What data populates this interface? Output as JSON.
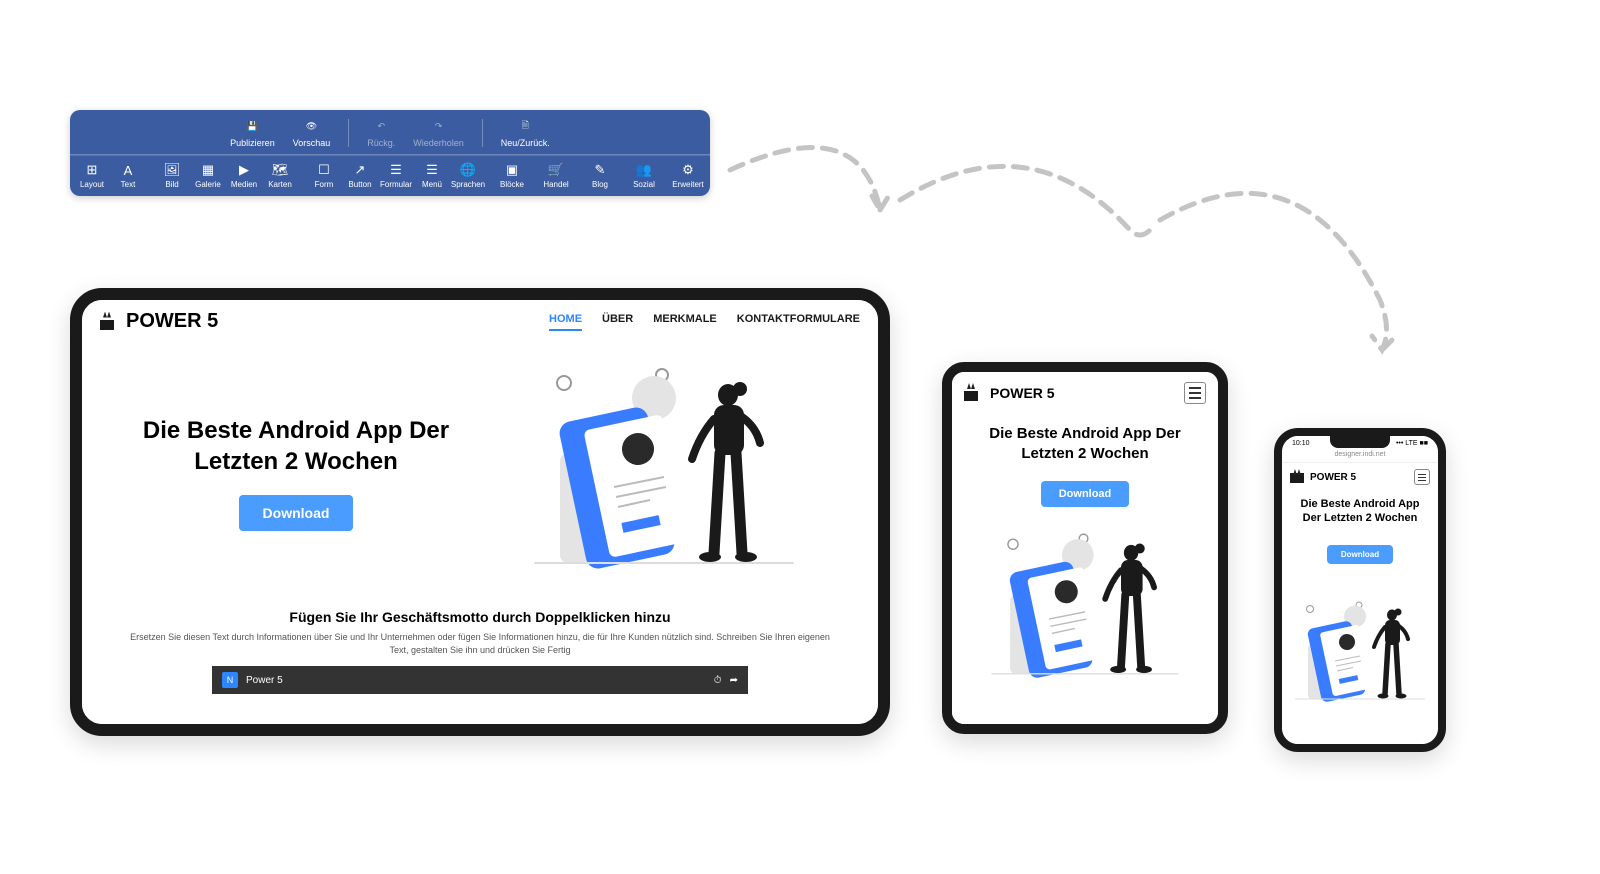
{
  "toolbar": {
    "top": {
      "publish": "Publizieren",
      "preview": "Vorschau",
      "undo": "Rückg.",
      "redo": "Wiederholen",
      "new": "Neu/Zurück."
    },
    "bottom": {
      "layout": "Layout",
      "text": "Text",
      "bild": "Bild",
      "galerie": "Galerie",
      "medien": "Medien",
      "karten": "Karten",
      "form": "Form",
      "button": "Button",
      "formular": "Formular",
      "menu": "Menü",
      "sprachen": "Sprachen",
      "blocke": "Blöcke",
      "handel": "Handel",
      "blog": "Blog",
      "sozial": "Sozial",
      "erweitert": "Erweitert"
    }
  },
  "site": {
    "brand": "POWER 5",
    "nav": {
      "home": "HOME",
      "uber": "ÜBER",
      "merkmale": "MERKMALE",
      "kontakt": "KONTAKTFORMULARE"
    },
    "hero_title": "Die Beste Android App Der Letzten 2 Wochen",
    "download": "Download",
    "motto_heading": "Fügen Sie Ihr Geschäftsmotto durch Doppelklicken hinzu",
    "motto_body": "Ersetzen Sie diesen Text durch Informationen über Sie und Ihr Unternehmen oder fügen Sie Informationen hinzu, die für Ihre Kunden nützlich sind. Schreiben Sie Ihren eigenen Text, gestalten Sie ihn und drücken Sie Fertig",
    "video_title": "Power 5",
    "video_badge": "N"
  },
  "phone": {
    "time": "10:10",
    "signal": "••• LTE ■■",
    "url": "designer.indi.net"
  }
}
